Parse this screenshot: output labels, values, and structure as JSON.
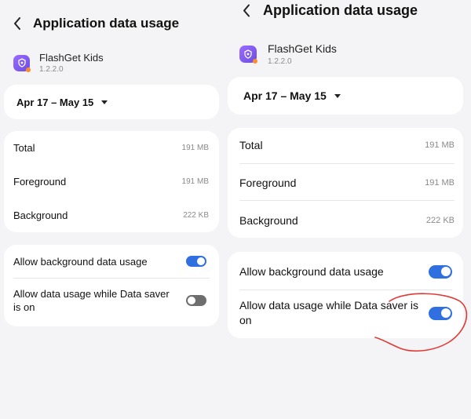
{
  "left": {
    "title": "Application data usage",
    "app": {
      "name": "FlashGet Kids",
      "version": "1.2.2.0"
    },
    "date_range": "Apr 17 – May 15",
    "usage": [
      {
        "label": "Total",
        "value": "191 MB"
      },
      {
        "label": "Foreground",
        "value": "191 MB"
      },
      {
        "label": "Background",
        "value": "222 KB"
      }
    ],
    "settings": [
      {
        "label": "Allow background data usage",
        "on": true
      },
      {
        "label": "Allow data usage while Data saver is on",
        "on": false
      }
    ]
  },
  "right": {
    "title": "Application data usage",
    "app": {
      "name": "FlashGet Kids",
      "version": "1.2.2.0"
    },
    "date_range": "Apr 17 – May 15",
    "usage": [
      {
        "label": "Total",
        "value": "191 MB"
      },
      {
        "label": "Foreground",
        "value": "191 MB"
      },
      {
        "label": "Background",
        "value": "222 KB"
      }
    ],
    "settings": [
      {
        "label": "Allow background data usage",
        "on": true
      },
      {
        "label": "Allow data usage while Data saver is on",
        "on": true
      }
    ]
  },
  "colors": {
    "toggle_on": "#2f6fe0",
    "toggle_off": "#6e6e6e",
    "annotation": "#e03a35"
  },
  "icons": {
    "back": "chevron-left-icon",
    "app": "flashget-kids-app-icon",
    "dropdown": "caret-down-icon"
  }
}
